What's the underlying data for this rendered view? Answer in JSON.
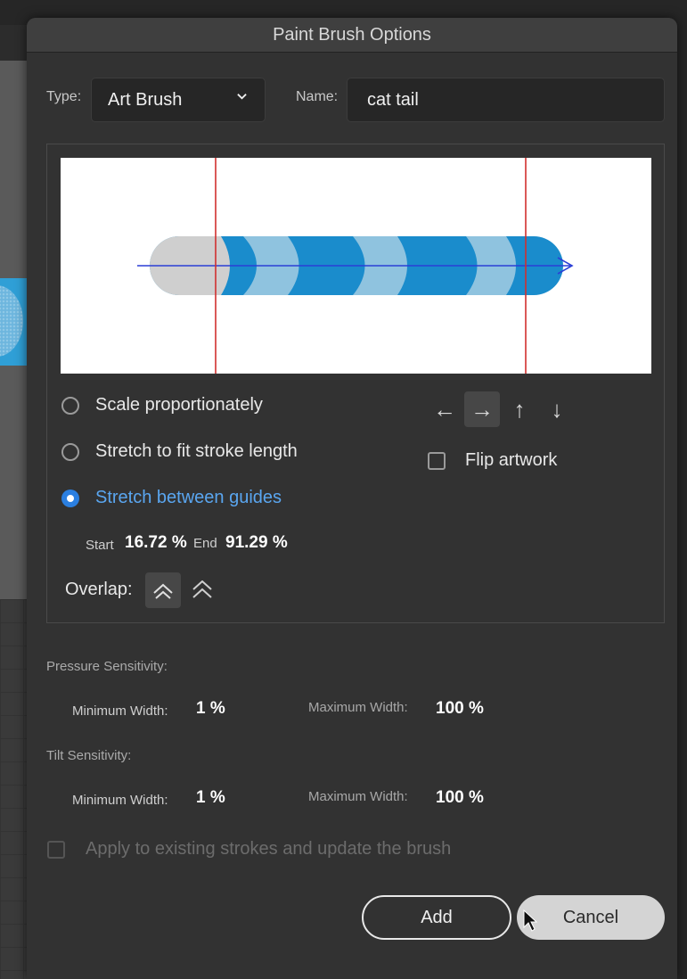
{
  "dialog": {
    "title": "Paint Brush Options"
  },
  "type": {
    "label": "Type:",
    "value": "Art Brush"
  },
  "name": {
    "label": "Name:",
    "value": "cat tail"
  },
  "scale_options": [
    {
      "label": "Scale proportionately",
      "selected": false
    },
    {
      "label": "Stretch to fit stroke length",
      "selected": false
    },
    {
      "label": "Stretch between guides",
      "selected": true
    }
  ],
  "guides": {
    "start_label": "Start",
    "start_value": "16.72 %",
    "end_label": "End",
    "end_value": "91.29 %"
  },
  "direction": {
    "buttons": [
      "←",
      "→",
      "↑",
      "↓"
    ],
    "selected": "→"
  },
  "flip": {
    "label": "Flip artwork",
    "checked": false
  },
  "overlap": {
    "label": "Overlap:"
  },
  "pressure": {
    "title": "Pressure Sensitivity:",
    "min_label": "Minimum Width:",
    "min_value": "1 %",
    "max_label": "Maximum Width:",
    "max_value": "100 %"
  },
  "tilt": {
    "title": "Tilt Sensitivity:",
    "min_label": "Minimum Width:",
    "min_value": "1 %",
    "max_label": "Maximum Width:",
    "max_value": "100 %"
  },
  "apply": {
    "label": "Apply to existing strokes and update the brush",
    "checked": false,
    "enabled": false
  },
  "buttons": {
    "add": "Add",
    "cancel": "Cancel"
  },
  "colors": {
    "accent": "#2b7fe0",
    "brush_blue": "#1a8ccc",
    "brush_light": "#8fc3df",
    "guide_red": "#d0302f"
  }
}
